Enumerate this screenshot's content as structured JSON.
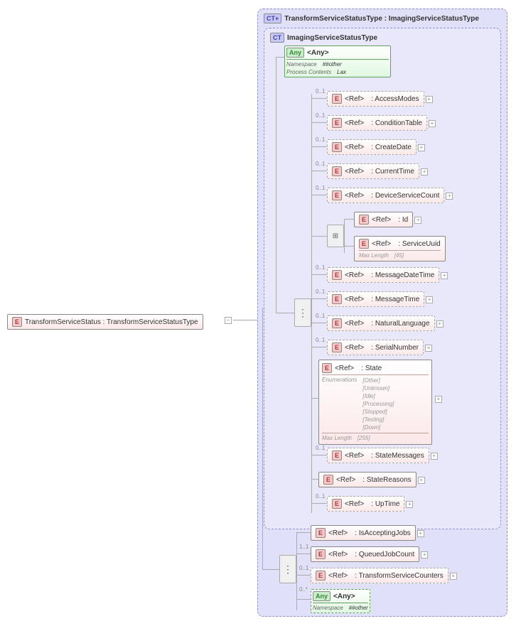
{
  "root": {
    "tag": "E",
    "label": "TransformServiceStatus : TransformServiceStatusType"
  },
  "outerCT": {
    "tag": "CT+",
    "label": "TransformServiceStatusType : ImagingServiceStatusType"
  },
  "innerCT": {
    "tag": "CT",
    "label": "ImagingServiceStatusType"
  },
  "anyBlock": {
    "tag": "Any",
    "label": "<Any>",
    "ns_label": "Namespace",
    "ns_value": "##other",
    "pc_label": "Process Contents",
    "pc_value": "Lax"
  },
  "tags": {
    "E": "E",
    "Any": "Any"
  },
  "ref_label": "<Ref>",
  "elements": {
    "access": ": AccessModes",
    "condition": ": ConditionTable",
    "create": ": CreateDate",
    "current": ": CurrentTime",
    "devcount": ": DeviceServiceCount",
    "id": ": Id",
    "uuid": ": ServiceUuid",
    "uuid_ml": "Max Length",
    "uuid_ml_v": "[45]",
    "msgdt": ": MessageDateTime",
    "msgt": ": MessageTime",
    "lang": ": NaturalLanguage",
    "serial": ": SerialNumber",
    "state": ": State",
    "state_enum_label": "Enumerations",
    "state_enums": [
      "[Other]",
      "[Unknown]",
      "[Idle]",
      "[Processing]",
      "[Stopped]",
      "[Testing]",
      "[Down]"
    ],
    "state_ml": "Max Length",
    "state_ml_v": "[255]",
    "statemsg": ": StateMessages",
    "statersn": ": StateReasons",
    "uptime": ": UpTime"
  },
  "outer_elements": {
    "accepting": ": IsAcceptingJobs",
    "queued": ": QueuedJobCount",
    "counters": ": TransformServiceCounters",
    "any_label": "<Any>",
    "any_ns_label": "Namespace",
    "any_ns_value": "##other"
  },
  "cardinalities": {
    "c01": "0..1",
    "c11": "1..1",
    "c0s": "0..*"
  }
}
